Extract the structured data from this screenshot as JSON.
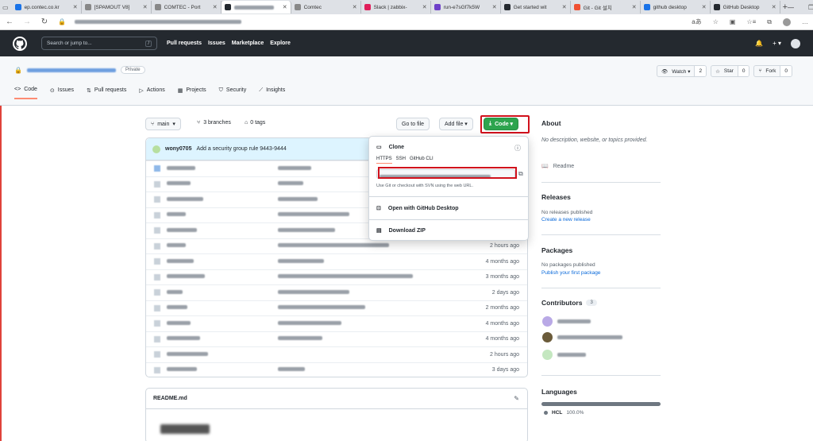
{
  "browser": {
    "tabs": [
      {
        "label": "ep.contec.co.kr",
        "color": "#1a73e8"
      },
      {
        "label": "[SPAMOUT V8]",
        "color": "#888"
      },
      {
        "label": "COMTEC - Port",
        "color": "#888"
      },
      {
        "label": "",
        "color": "#24292f",
        "active": true
      },
      {
        "label": "Comtec",
        "color": "#888"
      },
      {
        "label": "Slack | zabbix-",
        "color": "#e01e5a"
      },
      {
        "label": "run-e7sGf7k5W",
        "color": "#6e40c9"
      },
      {
        "label": "Get started wit",
        "color": "#24292f"
      },
      {
        "label": "Git - Git 설치",
        "color": "#f05032"
      },
      {
        "label": "github desktop",
        "color": "#1a73e8"
      },
      {
        "label": "GitHub Desktop",
        "color": "#24292f"
      }
    ],
    "tab_close": "✕",
    "new_tab": "+",
    "window_controls": [
      "—",
      "❐",
      "✕"
    ]
  },
  "gh": {
    "search_placeholder": "Search or jump to...",
    "search_kbd": "/",
    "nav": [
      "Pull requests",
      "Issues",
      "Marketplace",
      "Explore"
    ],
    "bell": "🔔",
    "plus": "+ ▾"
  },
  "repo": {
    "visibility": "Private",
    "watch": "Watch ▾",
    "watch_count": "2",
    "star": "Star",
    "star_count": "0",
    "fork": "Fork",
    "fork_count": "0",
    "tabs": [
      "Code",
      "Issues",
      "Pull requests",
      "Actions",
      "Projects",
      "Security",
      "Insights"
    ]
  },
  "toolbar": {
    "branch": "main",
    "branches": "3 branches",
    "tags": "0 tags",
    "goto_file": "Go to file",
    "add_file": "Add file ▾",
    "code": "Code ▾"
  },
  "commit": {
    "author": "wony0705",
    "message": "Add a security group rule 9443-9444"
  },
  "files": [
    {
      "dir": true,
      "age": ""
    },
    {
      "dir": false,
      "age": ""
    },
    {
      "dir": false,
      "age": ""
    },
    {
      "dir": false,
      "age": ""
    },
    {
      "dir": false,
      "age": ""
    },
    {
      "dir": false,
      "age": "2 hours ago"
    },
    {
      "dir": false,
      "age": "4 months ago"
    },
    {
      "dir": false,
      "age": "3 months ago"
    },
    {
      "dir": false,
      "age": "2 days ago"
    },
    {
      "dir": false,
      "age": "2 months ago"
    },
    {
      "dir": false,
      "age": "4 months ago"
    },
    {
      "dir": false,
      "age": "4 months ago"
    },
    {
      "dir": false,
      "age": "2 hours ago"
    },
    {
      "dir": false,
      "age": "3 days ago"
    }
  ],
  "clone": {
    "title": "Clone",
    "tabs": [
      "HTTPS",
      "SSH",
      "GitHub CLI"
    ],
    "hint": "Use Git or checkout with SVN using the web URL.",
    "open_desktop": "Open with GitHub Desktop",
    "download_zip": "Download ZIP"
  },
  "readme": {
    "title": "README.md"
  },
  "sidebar": {
    "about_title": "About",
    "about_text": "No description, website, or topics provided.",
    "readme_link": "Readme",
    "releases_title": "Releases",
    "releases_text": "No releases published",
    "releases_link": "Create a new release",
    "packages_title": "Packages",
    "packages_text": "No packages published",
    "packages_link": "Publish your first package",
    "contributors_title": "Contributors",
    "contributors_count": "3",
    "languages_title": "Languages",
    "lang_name": "HCL",
    "lang_pct": "100.0%"
  },
  "colors": {
    "code_green": "#2da44e",
    "highlight_red": "#d1111c",
    "accent_orange": "#fd8c73",
    "lang_bar": "#6e7781"
  }
}
